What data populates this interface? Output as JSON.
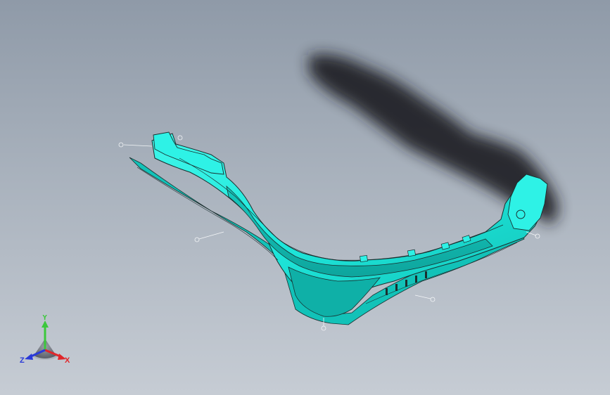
{
  "viewport": {
    "background_top": "#8f9aa8",
    "background_bottom": "#c6ccd4"
  },
  "model": {
    "part_color": "#19ecdf",
    "part_shade": "#11b8b0",
    "edge_color": "#1a2f2f",
    "shadow_color": "#1c1f22"
  },
  "triad": {
    "x_label": "X",
    "y_label": "Y",
    "z_label": "Z",
    "x_color": "#e0262a",
    "y_color": "#3cc83c",
    "z_color": "#2a3ad8"
  }
}
